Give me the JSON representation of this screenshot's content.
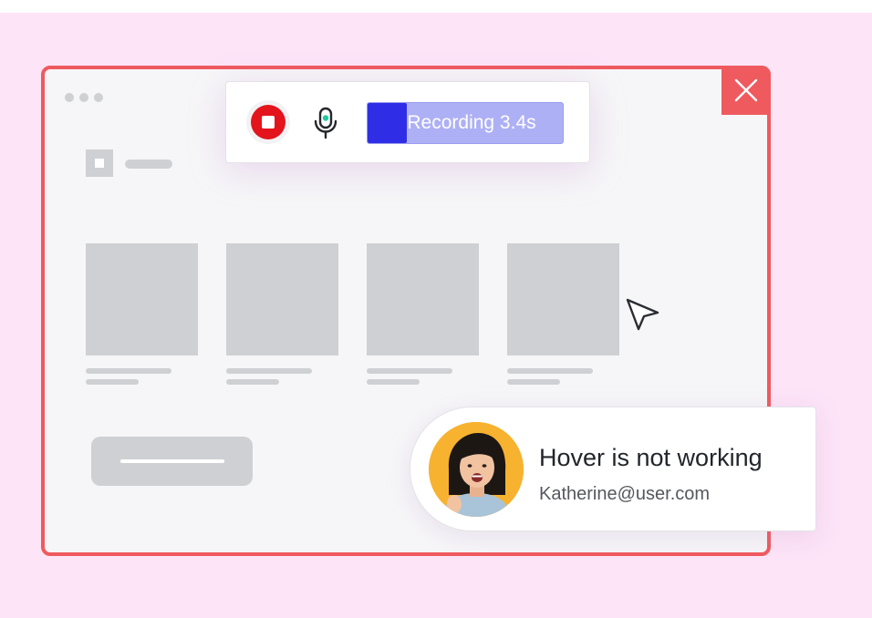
{
  "recorder": {
    "progress_label": "Recording 3.4s",
    "progress_fraction": 0.2,
    "stop_icon": "stop-icon",
    "mic_icon": "microphone-icon"
  },
  "window": {
    "close_icon": "close-icon",
    "card_count": 4
  },
  "comment": {
    "title": "Hover is not working",
    "email": "Katherine@user.com"
  },
  "colors": {
    "background": "#fde4f7",
    "window_border": "#ef5a5f",
    "stop_red": "#e3141c",
    "progress_fill": "#2f2ee6",
    "progress_track": "#aeb0f5",
    "avatar_bg": "#f7b230"
  }
}
